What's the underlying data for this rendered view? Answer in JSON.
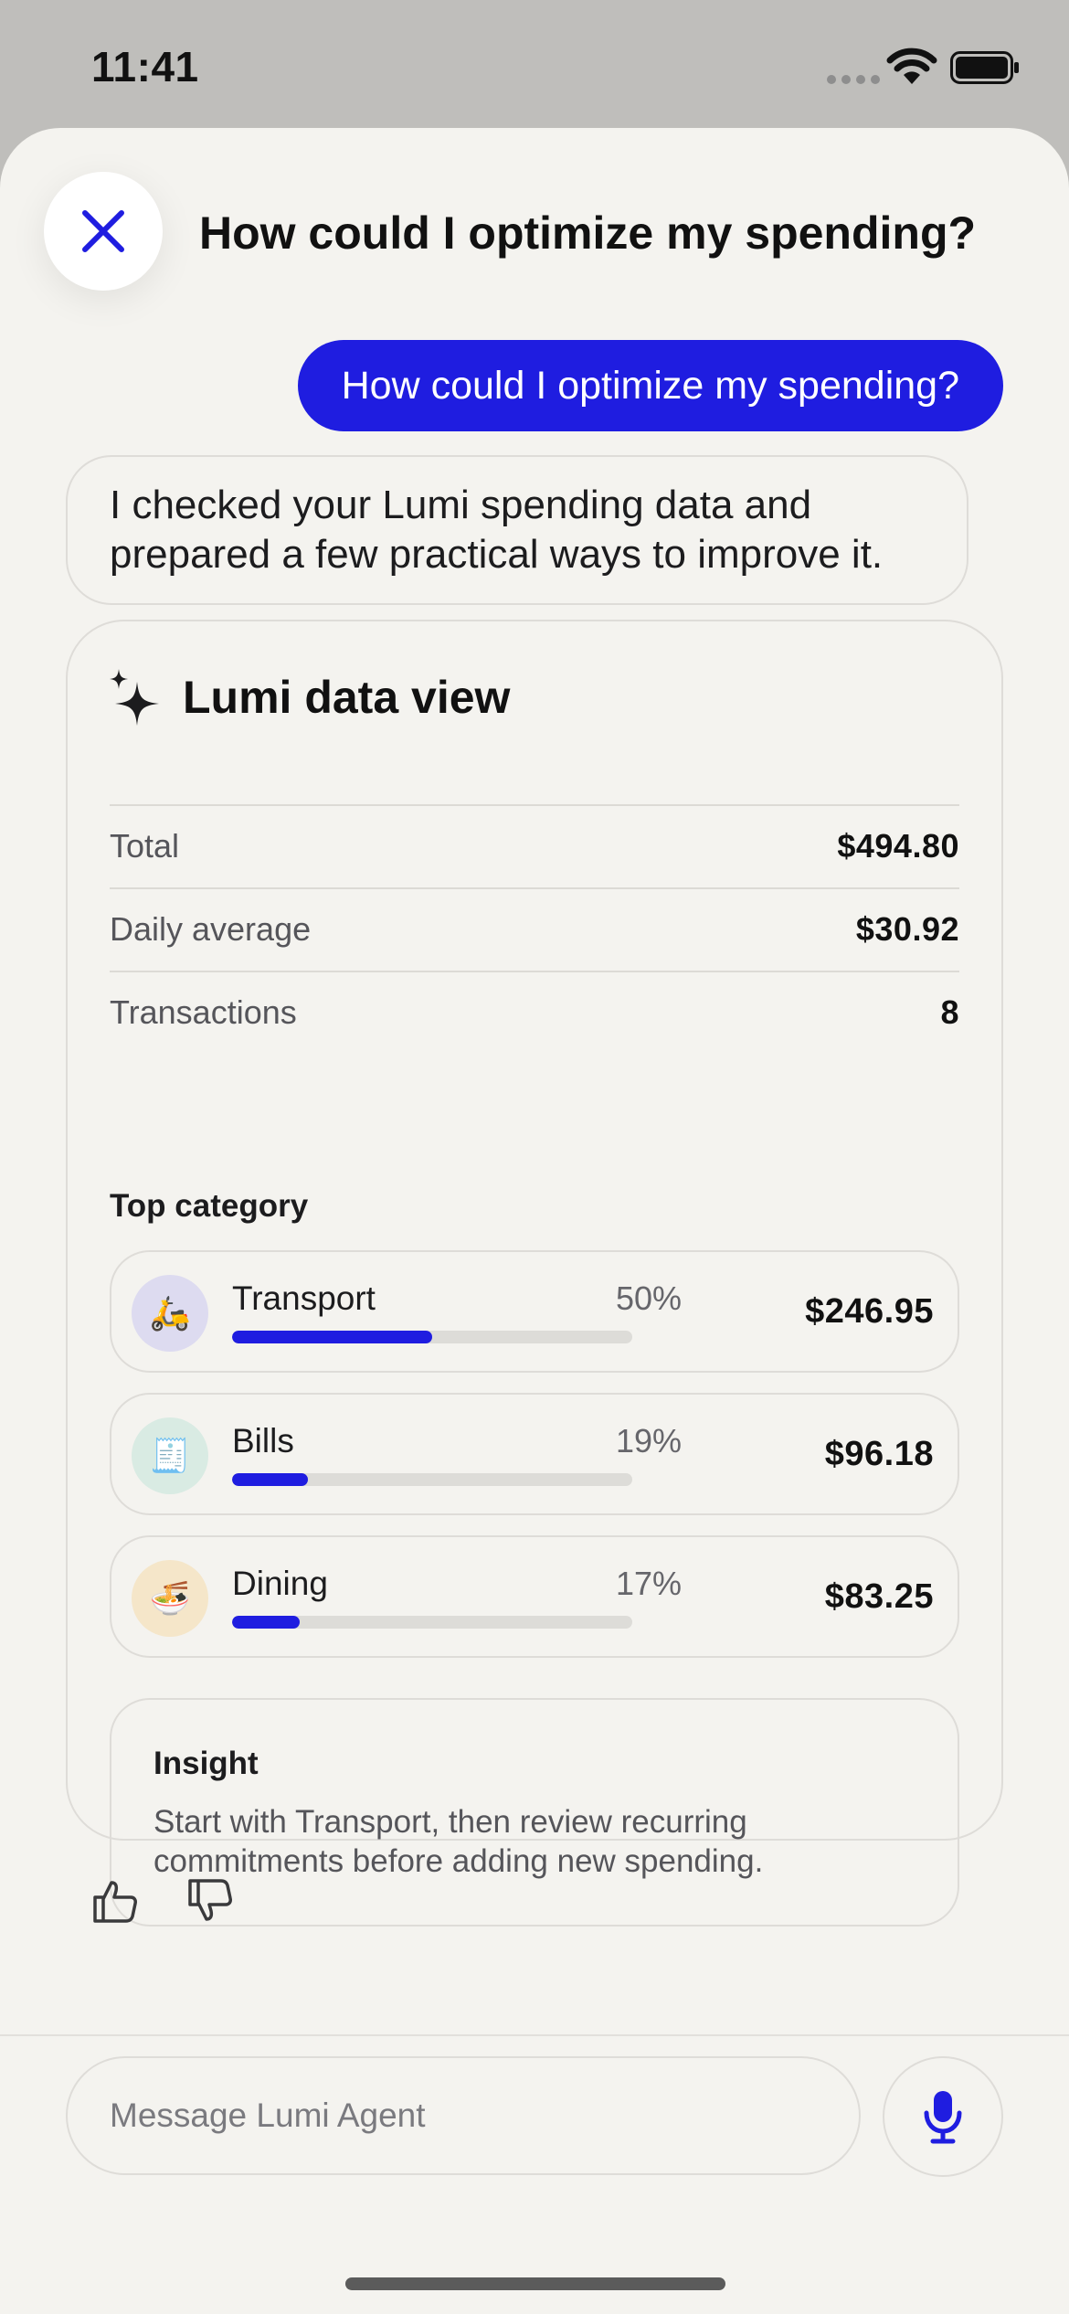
{
  "status_bar": {
    "time": "11:41"
  },
  "header": {
    "title": "How could I optimize my spending?"
  },
  "chat": {
    "user_message": "How could I optimize my spending?",
    "agent_message": "I checked your Lumi spending data and prepared a few practical ways to improve it."
  },
  "data_view": {
    "title": "Lumi data view",
    "metrics": [
      {
        "label": "Total",
        "value": "$494.80"
      },
      {
        "label": "Daily average",
        "value": "$30.92"
      },
      {
        "label": "Transactions",
        "value": "8"
      }
    ],
    "top_category_label": "Top category",
    "categories": [
      {
        "name": "Transport",
        "percent": "50%",
        "share": 0.5,
        "amount": "$246.95",
        "icon": "scooter-icon",
        "icon_glyph": "🛵",
        "icon_bg": "#dddbf0"
      },
      {
        "name": "Bills",
        "percent": "19%",
        "share": 0.19,
        "amount": "$96.18",
        "icon": "receipt-icon",
        "icon_glyph": "🧾",
        "icon_bg": "#d9ebe3"
      },
      {
        "name": "Dining",
        "percent": "17%",
        "share": 0.17,
        "amount": "$83.25",
        "icon": "noodles-icon",
        "icon_glyph": "🍜",
        "icon_bg": "#f5e6c9"
      }
    ],
    "insight": {
      "title": "Insight",
      "text": "Start with Transport, then review recurring commitments before adding new spending."
    }
  },
  "composer": {
    "placeholder": "Message Lumi Agent"
  },
  "colors": {
    "accent": "#1f1de0",
    "background": "#f4f3ef",
    "border": "#dedcd8"
  }
}
